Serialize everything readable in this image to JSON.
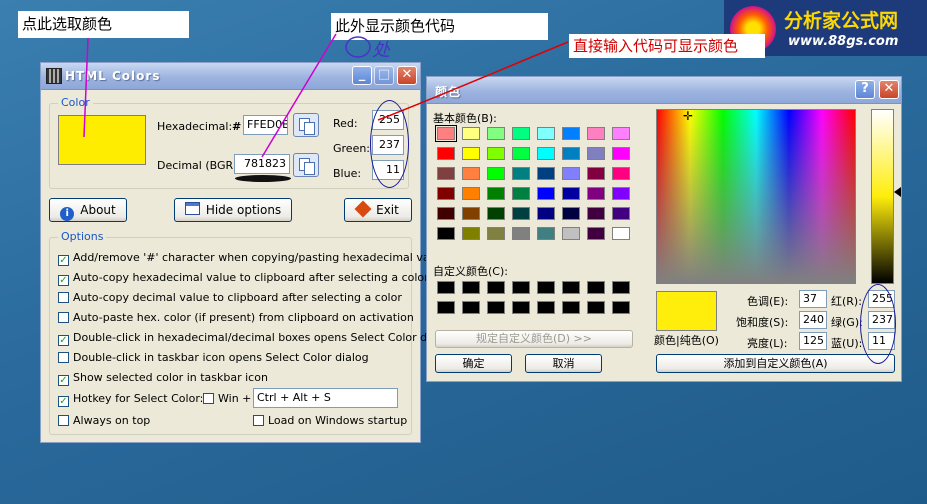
{
  "annotations": {
    "click_here": "点此选取颜色",
    "show_code": "此外显示颜色代码",
    "direct_input": "直接输入代码可显示颜色",
    "handwriting": "处"
  },
  "logo": {
    "name": "分析家公式网",
    "url": "www.88gs.com"
  },
  "html_colors": {
    "title": "HTML Colors",
    "color_group": "Color",
    "swatch_color": "#FFED00",
    "hex_label": "Hexadecimal:",
    "hash": "#",
    "hex_value": "FFED0B",
    "dec_label": "Decimal (BGR):",
    "dec_value": "781823",
    "red_label": "Red:",
    "green_label": "Green:",
    "blue_label": "Blue:",
    "red": "255",
    "green": "237",
    "blue": "11",
    "about": "About",
    "hide": "Hide options",
    "exit": "Exit",
    "options_group": "Options",
    "options": [
      {
        "label": "Add/remove '#' character when copying/pasting hexadecimal value",
        "checked": true
      },
      {
        "label": "Auto-copy hexadecimal value to clipboard after selecting a color",
        "checked": true
      },
      {
        "label": "Auto-copy decimal value to clipboard after selecting a color",
        "checked": false
      },
      {
        "label": "Auto-paste hex. color (if present) from clipboard on activation",
        "checked": false
      },
      {
        "label": "Double-click in hexadecimal/decimal boxes opens Select Color dialog",
        "checked": true
      },
      {
        "label": "Double-click in taskbar icon opens Select Color dialog",
        "checked": false
      },
      {
        "label": "Show selected color in taskbar icon",
        "checked": true
      }
    ],
    "hotkey_label": "Hotkey for Select Color:",
    "win_label": "Win +",
    "hotkey_value": "Ctrl + Alt + S",
    "always_top": "Always on top",
    "load_startup": "Load on Windows startup"
  },
  "color_dialog": {
    "title": "颜色",
    "basic_label": "基本颜色(B):",
    "custom_label": "自定义颜色(C):",
    "define_btn": "规定自定义颜色(D) >>",
    "ok": "确定",
    "cancel": "取消",
    "preview_label": "颜色|纯色(O)",
    "hue_label": "色调(E):",
    "sat_label": "饱和度(S):",
    "lum_label": "亮度(L):",
    "red_label": "红(R):",
    "green_label": "绿(G):",
    "blue_label": "蓝(U):",
    "hue": "37",
    "sat": "240",
    "lum": "125",
    "red": "255",
    "green": "237",
    "blue": "11",
    "add_custom": "添加到自定义颜色(A)",
    "selected_color": "#FFED0B",
    "basic_colors": [
      "#ff8080",
      "#ffff80",
      "#80ff80",
      "#00ff80",
      "#80ffff",
      "#0080ff",
      "#ff80c0",
      "#ff80ff",
      "#ff0000",
      "#ffff00",
      "#80ff00",
      "#00ff40",
      "#00ffff",
      "#0080c0",
      "#8080c0",
      "#ff00ff",
      "#804040",
      "#ff8040",
      "#00ff00",
      "#008080",
      "#004080",
      "#8080ff",
      "#800040",
      "#ff0080",
      "#800000",
      "#ff8000",
      "#008000",
      "#008040",
      "#0000ff",
      "#0000a0",
      "#800080",
      "#8000ff",
      "#400000",
      "#804000",
      "#004000",
      "#004040",
      "#000080",
      "#000040",
      "#400040",
      "#400080",
      "#000000",
      "#808000",
      "#808040",
      "#808080",
      "#408080",
      "#c0c0c0",
      "#400040",
      "#ffffff"
    ]
  }
}
